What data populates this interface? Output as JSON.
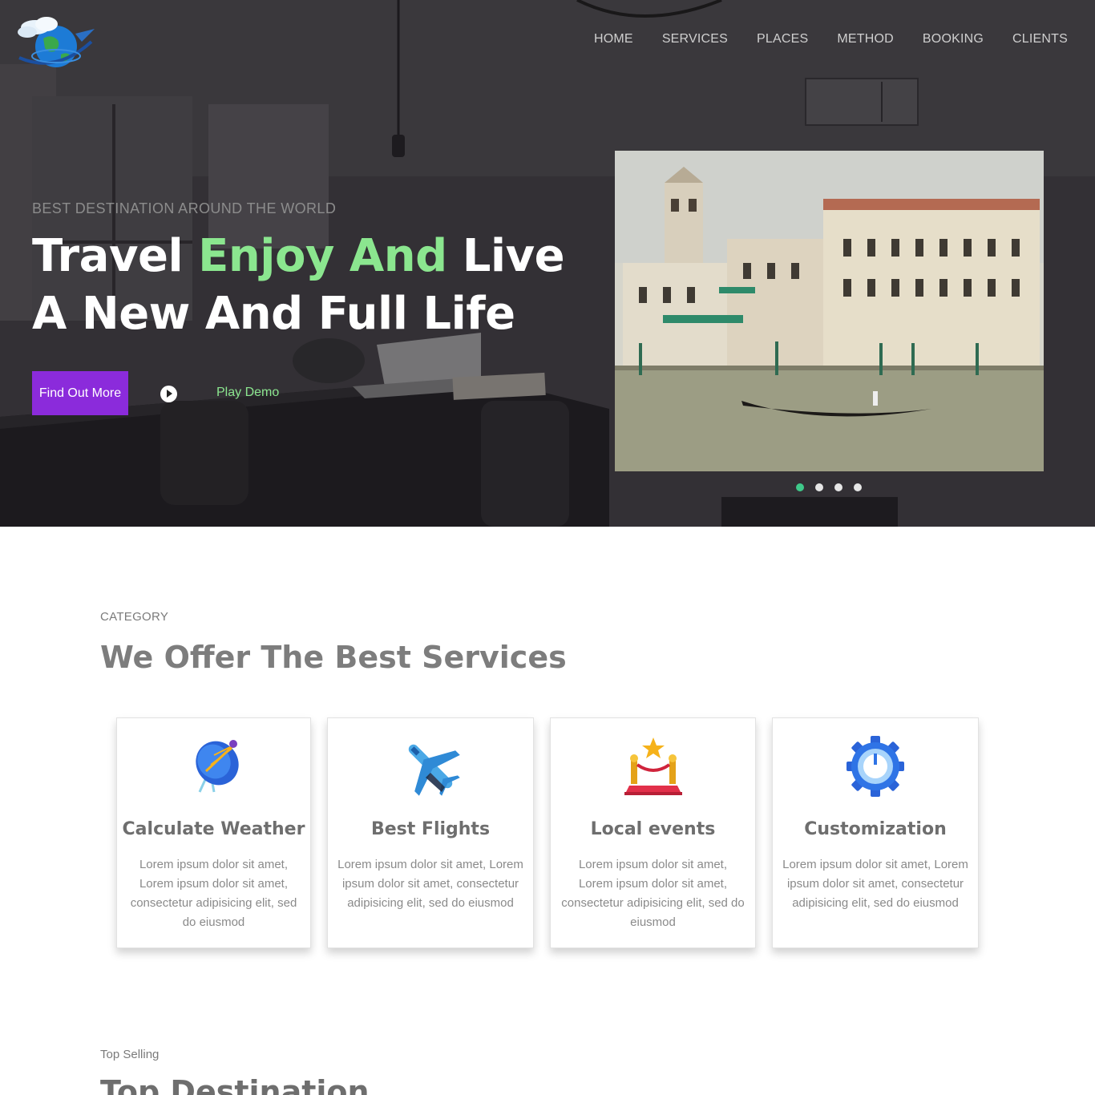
{
  "brand": {
    "logo_icon": "globe-plane-logo"
  },
  "nav": {
    "items": [
      "HOME",
      "SERVICES",
      "PLACES",
      "METHOD",
      "BOOKING",
      "CLIENTS"
    ]
  },
  "hero": {
    "eyebrow": "BEST DESTINATION AROUND THE WORLD",
    "headline_part1": "Travel ",
    "headline_accent": "Enjoy And",
    "headline_part2": " Live",
    "headline_line2": "A New And Full Life",
    "cta_label": "Find Out More",
    "play_label": "Play Demo",
    "slide_icon": "venice-canal-photo",
    "slides_total": 4,
    "active_slide": 1,
    "colors": {
      "accent_green": "#8be68f",
      "cta_purple": "#8b2bdb",
      "dot_active": "#3fc98a"
    }
  },
  "services": {
    "category_label": "CATEGORY",
    "title": "We Offer The Best Services",
    "cards": [
      {
        "icon": "satellite-dish-icon",
        "title": "Calculate Weather",
        "text": "Lorem ipsum dolor sit amet, Lorem ipsum dolor sit amet, consectetur adipisicing elit, sed do eiusmod"
      },
      {
        "icon": "airplane-icon",
        "title": "Best Flights",
        "text": "Lorem ipsum dolor sit amet, Lorem ipsum dolor sit amet, consectetur adipisicing elit, sed do eiusmod"
      },
      {
        "icon": "red-carpet-star-icon",
        "title": "Local events",
        "text": "Lorem ipsum dolor sit amet, Lorem ipsum dolor sit amet, consectetur adipisicing elit, sed do eiusmod"
      },
      {
        "icon": "gear-dial-icon",
        "title": "Customization",
        "text": "Lorem ipsum dolor sit amet, Lorem ipsum dolor sit amet, consectetur adipisicing elit, sed do eiusmod"
      }
    ]
  },
  "top_selling": {
    "label": "Top Selling",
    "title": "Top Destination"
  }
}
